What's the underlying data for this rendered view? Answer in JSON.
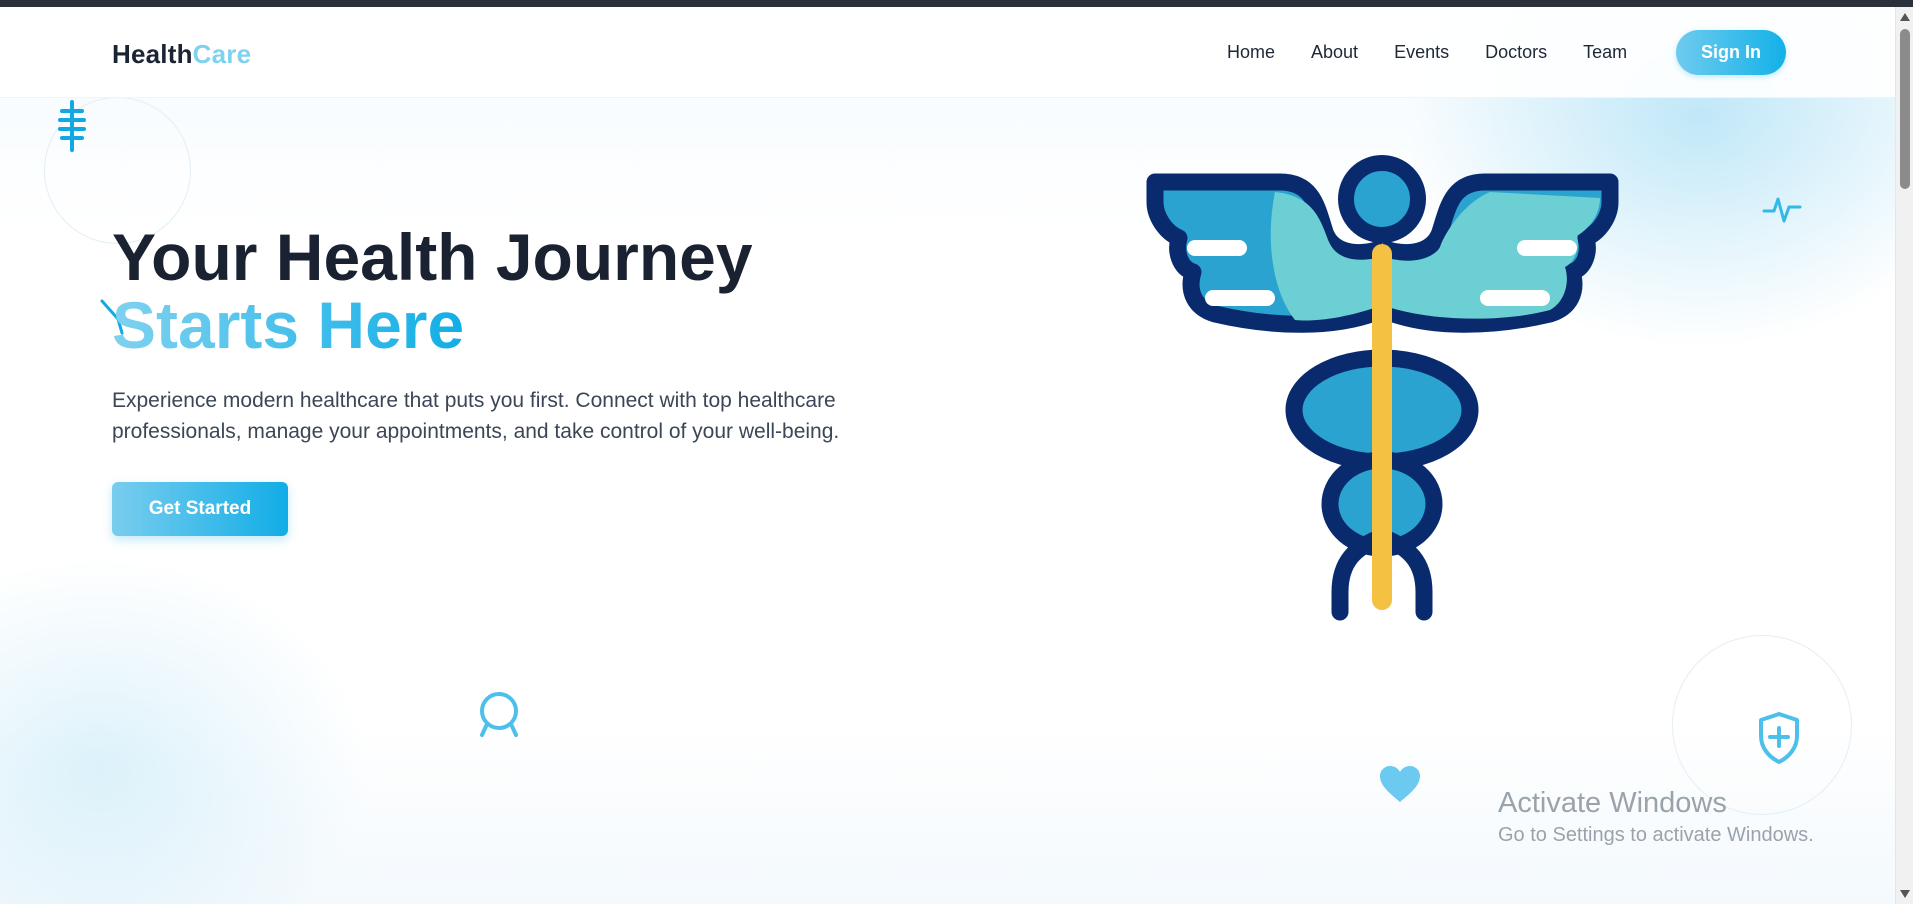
{
  "brand": {
    "part1": "Health",
    "part2": "Care"
  },
  "nav": {
    "items": [
      {
        "label": "Home"
      },
      {
        "label": "About"
      },
      {
        "label": "Events"
      },
      {
        "label": "Doctors"
      },
      {
        "label": "Team"
      }
    ],
    "signin_label": "Sign In"
  },
  "hero": {
    "title_line1": "Your Health Journey",
    "title_line2": "Starts Here",
    "description": "Experience modern healthcare that puts you first. Connect with top healthcare professionals, manage your appointments, and take control of your well-being.",
    "cta_label": "Get Started"
  },
  "decorations": [
    "spine-icon",
    "scalpel-icon",
    "pulse-icon",
    "stethoscope-icon",
    "heart-icon",
    "shield-plus-icon",
    "caduceus-illustration"
  ],
  "watermark": {
    "title": "Activate Windows",
    "subtitle": "Go to Settings to activate Windows."
  },
  "colors": {
    "accent": "#13b1e8",
    "accent_light": "#7fd2ef",
    "dark_text": "#1a2232",
    "caduceus_navy": "#0a2a6e",
    "caduceus_blue": "#2aa3d0",
    "caduceus_teal": "#6ccfd4",
    "caduceus_staff": "#f5c143"
  }
}
